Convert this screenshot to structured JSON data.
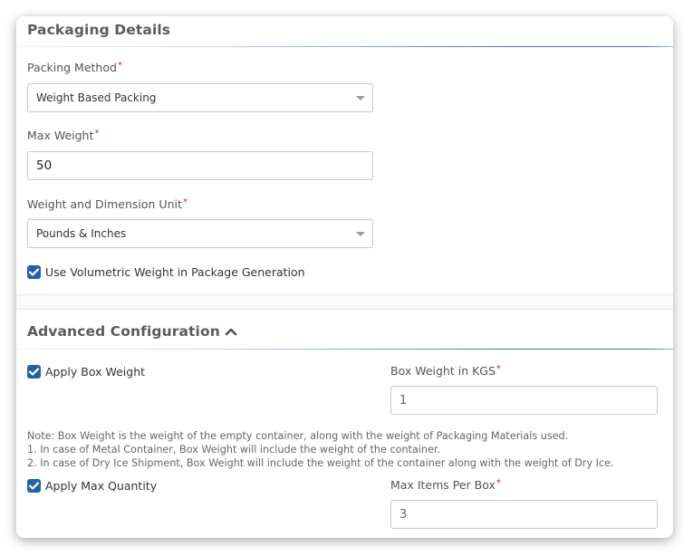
{
  "packaging": {
    "title": "Packaging Details",
    "packing_method": {
      "label": "Packing Method",
      "required_mark": "*",
      "value": "Weight Based Packing"
    },
    "max_weight": {
      "label": "Max Weight",
      "required_mark": "*",
      "value": "50"
    },
    "unit": {
      "label": "Weight and Dimension Unit",
      "required_mark": "*",
      "value": "Pounds & Inches"
    },
    "volumetric": {
      "label": "Use Volumetric Weight in Package Generation",
      "checked": true
    }
  },
  "advanced": {
    "title": "Advanced Configuration",
    "expanded": true,
    "apply_box_weight": {
      "label": "Apply Box Weight",
      "checked": true
    },
    "box_weight": {
      "label": "Box Weight in KGS",
      "required_mark": "*",
      "value": "1"
    },
    "note": {
      "line1": "Note: Box Weight is the weight of the empty container, along with the weight of Packaging Materials used.",
      "line2": "1. In case of Metal Container, Box Weight will include the weight of the container.",
      "line3": "2. In case of Dry Ice Shipment, Box Weight will include the weight of the container along with the weight of Dry Ice."
    },
    "apply_max_quantity": {
      "label": "Apply Max Quantity",
      "checked": true
    },
    "max_items": {
      "label": "Max Items Per Box",
      "required_mark": "*",
      "value": "3"
    }
  },
  "colors": {
    "accent": "#2361a8",
    "required": "#e02020"
  }
}
